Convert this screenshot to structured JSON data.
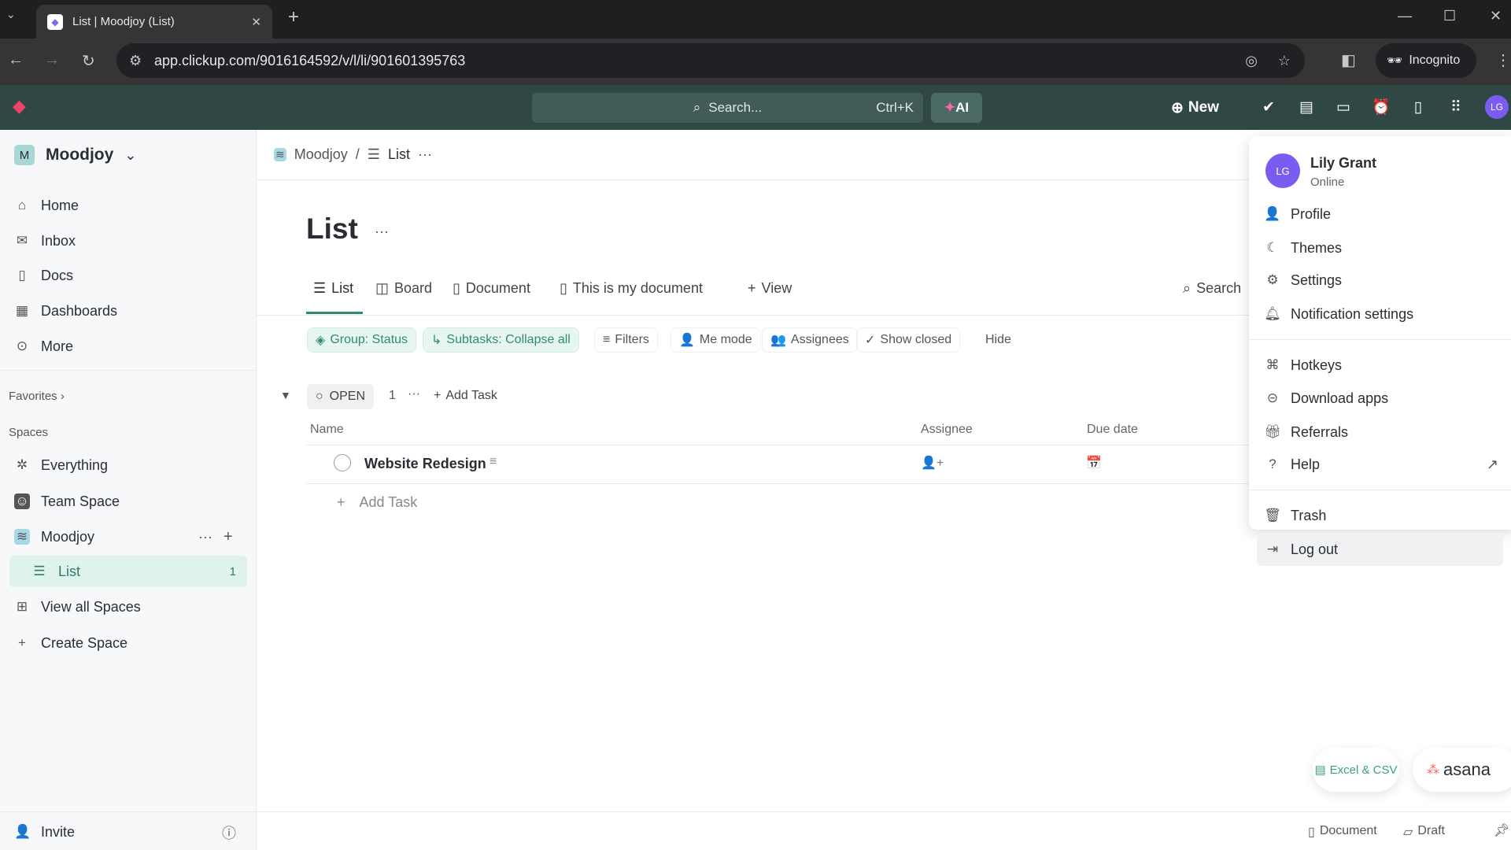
{
  "browser": {
    "tab_title": "List | Moodjoy (List)",
    "url": "app.clickup.com/9016164592/v/l/li/901601395763",
    "profile": "Incognito"
  },
  "header": {
    "search_placeholder": "Search...",
    "shortcut": "Ctrl+K",
    "ai": "AI",
    "new": "New",
    "avatar": "LG"
  },
  "sidebar": {
    "workspace": "Moodjoy",
    "workspace_initial": "M",
    "items": [
      {
        "label": "Home"
      },
      {
        "label": "Inbox"
      },
      {
        "label": "Docs"
      },
      {
        "label": "Dashboards"
      },
      {
        "label": "More"
      }
    ],
    "favorites": "Favorites",
    "spaces": "Spaces",
    "space_items": [
      {
        "label": "Everything"
      },
      {
        "label": "Team Space"
      },
      {
        "label": "Moodjoy"
      },
      {
        "label": "List",
        "count": "1"
      },
      {
        "label": "View all Spaces"
      },
      {
        "label": "Create Space"
      }
    ],
    "invite": "Invite"
  },
  "breadcrumb": {
    "space": "Moodjoy",
    "sep": "/",
    "list": "List"
  },
  "main": {
    "title": "List",
    "tabs": [
      "List",
      "Board",
      "Document",
      "This is my document",
      "View"
    ],
    "search": "Search",
    "filters": [
      "Group: Status",
      "Subtasks: Collapse all",
      "Filters",
      "Me mode",
      "Assignees",
      "Show closed",
      "Hide"
    ],
    "group": {
      "status": "OPEN",
      "count": "1",
      "add_task": "Add Task"
    },
    "columns": [
      "Name",
      "Assignee",
      "Due date"
    ],
    "tasks": [
      {
        "name": "Website Redesign"
      }
    ],
    "add_task": "Add Task"
  },
  "menu": {
    "user": "Lily Grant",
    "status": "Online",
    "avatar": "LG",
    "items": [
      "Profile",
      "Themes",
      "Settings",
      "Notification settings",
      "Hotkeys",
      "Download apps",
      "Referrals",
      "Help",
      "Trash",
      "Log out"
    ]
  },
  "imports": {
    "excel": "Excel & CSV",
    "asana": "asana"
  },
  "bottom": {
    "document": "Document",
    "draft": "Draft"
  },
  "colors": {
    "header": "#2f4845",
    "accent": "#2e8c6f",
    "avatar": "#7b5cf0"
  }
}
